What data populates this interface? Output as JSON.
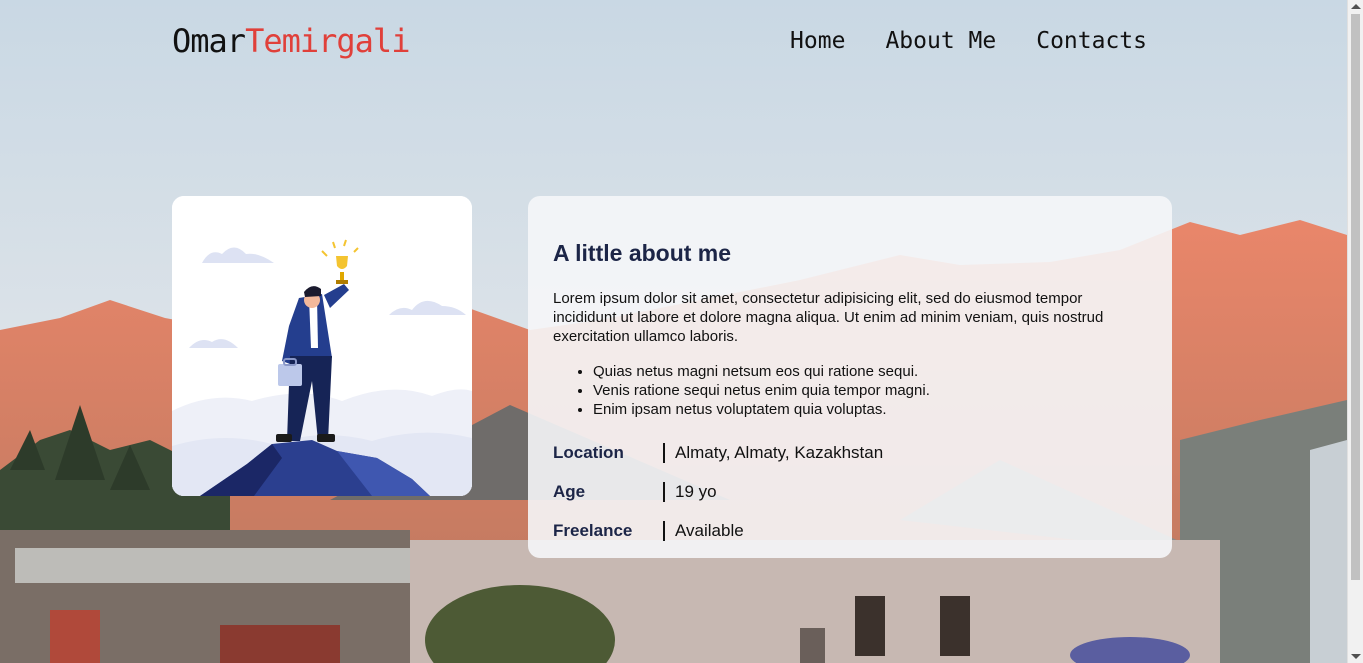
{
  "logo": {
    "first": "Omar",
    "last": "Temirgali"
  },
  "nav": {
    "home": "Home",
    "about": "About Me",
    "contacts": "Contacts"
  },
  "about": {
    "title": "A little about me",
    "paragraph": "Lorem ipsum dolor sit amet, consectetur adipisicing elit, sed do eiusmod tempor incididunt ut labore et dolore magna aliqua. Ut enim ad minim veniam, quis nostrud exercitation ullamco laboris.",
    "bullets": [
      "Quias netus magni netsum eos qui ratione sequi.",
      "Venis ratione sequi netus enim quia tempor magni.",
      "Enim ipsam netus voluptatem quia voluptas."
    ],
    "info": [
      {
        "label": "Location",
        "value": "Almaty, Almaty, Kazakhstan"
      },
      {
        "label": "Age",
        "value": "19 yo"
      },
      {
        "label": "Freelance",
        "value": "Available"
      }
    ]
  },
  "icons": {
    "illustration": "person-with-trophy-on-mountain-illustration"
  },
  "colors": {
    "accent": "#e0403a",
    "heading": "#1c2547",
    "text": "#111111"
  }
}
